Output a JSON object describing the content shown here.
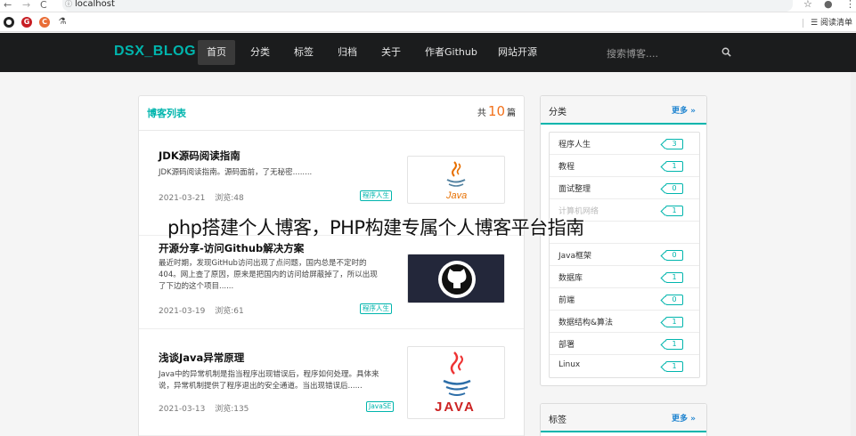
{
  "browser": {
    "back_icon": "←",
    "forward_icon": "→",
    "reload_icon": "C",
    "url": "localhost",
    "star_icon": "☆",
    "account_icon": "●",
    "menu_icon": "⋮",
    "reading_list_label": "阅读清单",
    "bookmarks": [
      {
        "icon": "github-icon",
        "glyph": "●",
        "color": "#222"
      },
      {
        "icon": "gitee-icon",
        "glyph": "G",
        "color": "#c71d23"
      },
      {
        "icon": "csdn-icon",
        "glyph": "C",
        "color": "#e96d36"
      },
      {
        "icon": "flask-icon",
        "glyph": "⚗",
        "color": "#555"
      }
    ]
  },
  "navbar": {
    "logo": "DSX_BLOG",
    "items": [
      "首页",
      "分类",
      "标签",
      "归档",
      "关于",
      "作者Github",
      "网站开源"
    ],
    "search_placeholder": "搜索博客...."
  },
  "blog_list": {
    "title": "博客列表",
    "count_prefix": "共",
    "count": "10",
    "count_suffix": "篇",
    "posts": [
      {
        "title": "JDK源码阅读指南",
        "desc": "JDK源码阅读指南。源码面前，了无秘密........",
        "date": "2021-03-21",
        "views": "浏览:48",
        "tag": "程序人生",
        "thumb": "java"
      },
      {
        "title": "开源分享-访问Github解决方案",
        "desc": "最近时期，发现GitHub访问出现了点问题，国内总是不定时的404。网上查了原因，原来是把国内的访问给屏蔽掉了，所以出现了下边的这个项目......",
        "date": "2021-03-19",
        "views": "浏览:61",
        "tag": "程序人生",
        "thumb": "github"
      },
      {
        "title": "浅谈Java异常原理",
        "desc": "Java中的异常机制是指当程序出现错误后，程序如何处理。具体来说，异常机制提供了程序退出的安全通道。当出现错误后......",
        "date": "2021-03-13",
        "views": "浏览:135",
        "tag": "JavaSE",
        "thumb": "java-big"
      }
    ]
  },
  "categories": {
    "title": "分类",
    "more": "更多 »",
    "items": [
      {
        "name": "程序人生",
        "count": "3"
      },
      {
        "name": "教程",
        "count": "1"
      },
      {
        "name": "面试整理",
        "count": "0"
      },
      {
        "name": "计算机网络",
        "count": "1"
      },
      {
        "name": "",
        "count": ""
      },
      {
        "name": "Java框架",
        "count": "0"
      },
      {
        "name": "数据库",
        "count": "1"
      },
      {
        "name": "前端",
        "count": "0"
      },
      {
        "name": "数据结构&算法",
        "count": "1"
      },
      {
        "name": "部署",
        "count": "1"
      },
      {
        "name": "Linux",
        "count": "1"
      }
    ]
  },
  "tags": {
    "title": "标签",
    "more": "更多 »"
  },
  "overlay_caption": "php搭建个人博客，PHP构建专属个人博客平台指南",
  "colors": {
    "accent": "#00b5ad",
    "navbar": "#1b1c1d",
    "count": "#f2711c",
    "link": "#2185d0"
  }
}
